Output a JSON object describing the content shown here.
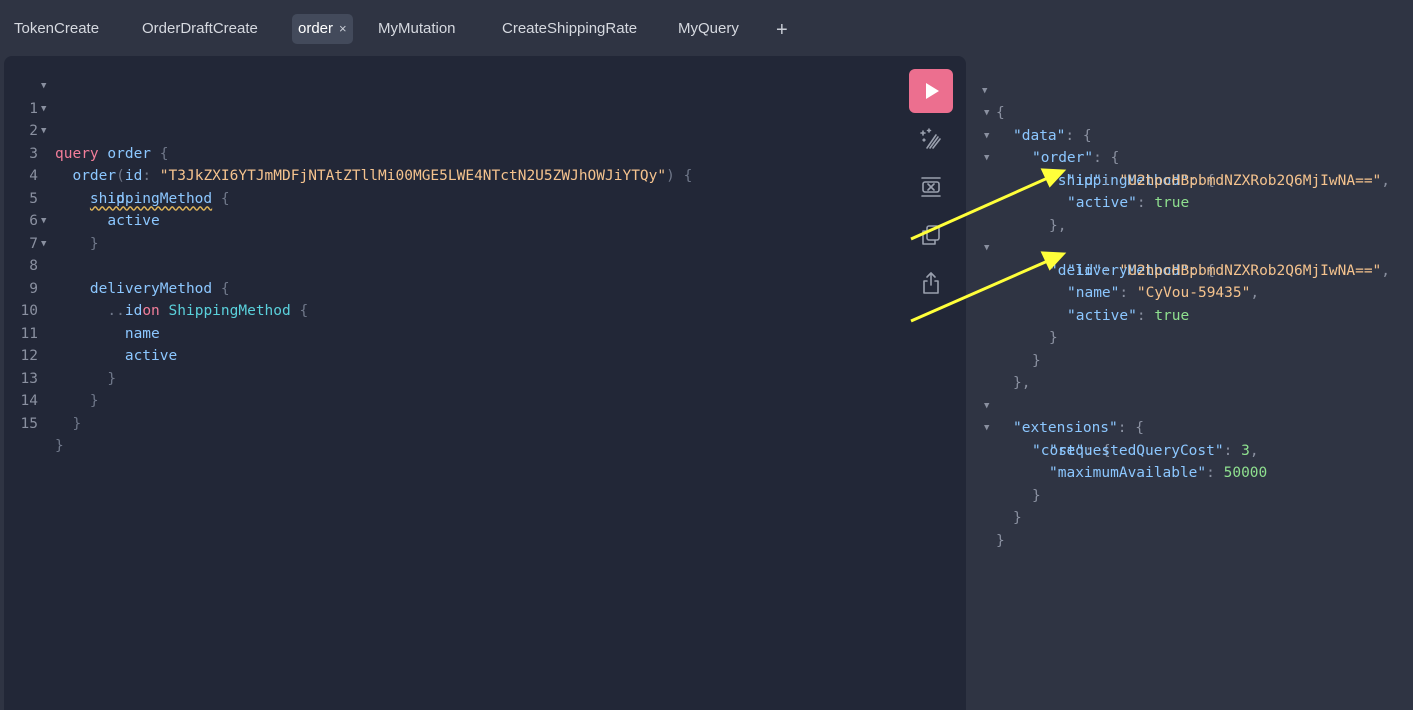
{
  "tabs": [
    {
      "label": "TokenCreate"
    },
    {
      "label": "OrderDraftCreate"
    },
    {
      "label": "order",
      "close": "×"
    },
    {
      "label": "MyMutation"
    },
    {
      "label": "CreateShippingRate"
    },
    {
      "label": "MyQuery"
    }
  ],
  "add_tab": "+",
  "editor": {
    "line_numbers": [
      "1",
      "2",
      "3",
      "4",
      "5",
      "6",
      "7",
      "8",
      "9",
      "10",
      "11",
      "12",
      "13",
      "14",
      "15"
    ],
    "fold_marker": "▼",
    "tokens": {
      "query_kw": "query",
      "op_name": "order",
      "open_brace": "{",
      "close_brace": "}",
      "order_field": "order",
      "paren_open": "(",
      "arg_name": "id",
      "colon": ":",
      "arg_value": "\"T3JkZXI6YTJmMDFjNTAtZTllMi00MGE5LWE4NTctN2U5ZWJhOWJiYTQy\"",
      "paren_close": ")",
      "shipping_method": "shippingMethod",
      "id": "id",
      "active": "active",
      "delivery_method": "deliveryMethod",
      "spread": "...",
      "on_kw": "on",
      "type_cond": "ShippingMethod",
      "name": "name"
    }
  },
  "toolbar": {
    "run_icon": "play-icon",
    "prettify_icon": "magic-wand-icon",
    "merge_icon": "merge-fragments-icon",
    "copy_icon": "copy-icon",
    "share_icon": "share-icon"
  },
  "result": {
    "fold_marker": "▼",
    "k_data": "\"data\"",
    "k_order": "\"order\"",
    "k_shipping": "\"shippingMethod\"",
    "k_id": "\"id\"",
    "k_active": "\"active\"",
    "k_delivery": "\"deliveryMethod\"",
    "k_name": "\"name\"",
    "k_extensions": "\"extensions\"",
    "k_cost": "\"cost\"",
    "k_requested": "\"requestedQueryCost\"",
    "k_max": "\"maximumAvailable\"",
    "shipping_id": "\"U2hpcHBpbmdNZXRob2Q6MjIwNA==\"",
    "shipping_active": "true",
    "delivery_id": "\"U2hpcHBpbmdNZXRob2Q6MjIwNA==\"",
    "delivery_name": "\"CyVou-59435\"",
    "delivery_active": "true",
    "requested_cost": "3",
    "max_available": "50000",
    "colon": ": ",
    "open_brace": "{",
    "close_brace": "}",
    "close_brace_comma": "},",
    "comma": ","
  },
  "annotation_color": "#ffff3a"
}
